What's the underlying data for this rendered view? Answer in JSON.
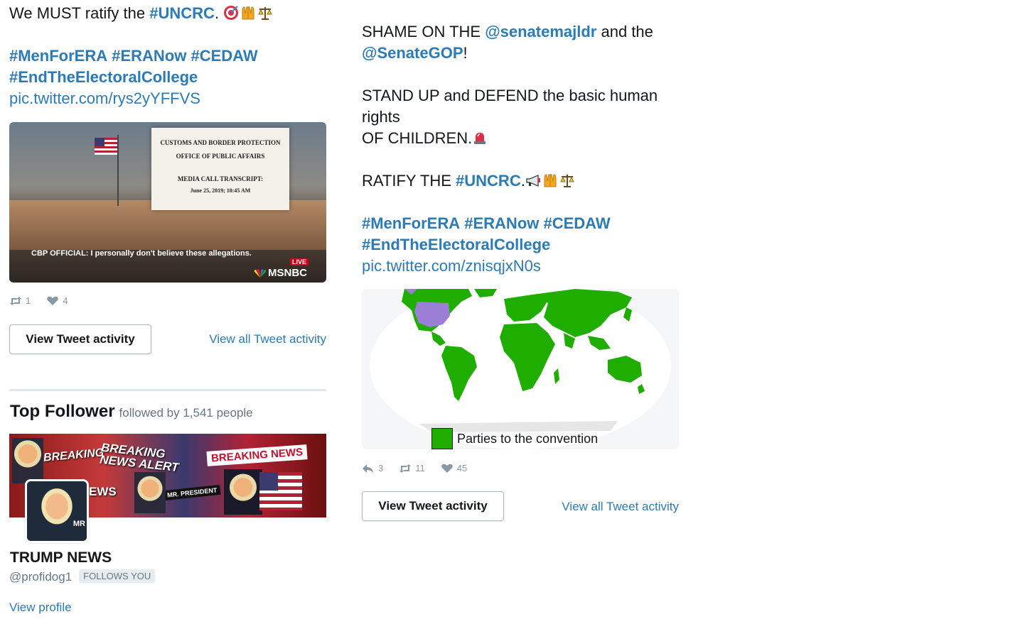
{
  "left_tweet": {
    "line1_prefix": "We MUST ratify the ",
    "line1_tag": "#UNCRC",
    "line1_suffix": ".",
    "emojis1": [
      "target-icon",
      "raised-hands-icon",
      "scales-icon"
    ],
    "tags_line1": [
      "#MenForERA",
      "#ERANow",
      "#CEDAW"
    ],
    "tags_line2": "#EndTheElectoralCollege",
    "pic_link": "pic.twitter.com/rys2yYFFVS",
    "media": {
      "doc_line1": "CUSTOMS AND BORDER PROTECTION",
      "doc_line2": "OFFICE OF PUBLIC AFFAIRS",
      "doc_line3": "MEDIA CALL TRANSCRIPT:",
      "doc_line4": "June 25, 2019; 10:45 AM",
      "caption": "CBP OFFICIAL: I personally don't believe these allegations.",
      "live": "LIVE",
      "network": "MSNBC"
    },
    "retweets": "1",
    "likes": "4",
    "view_button": "View Tweet activity",
    "view_all_link": "View all Tweet activity"
  },
  "top_follower": {
    "title": "Top Follower",
    "subtitle": "followed by 1,541 people",
    "banner_texts": [
      "BREAKING",
      "BREAKING NEWS ALERT",
      "BREAKING NEWS",
      "MR. PRESIDENT",
      "EWS"
    ],
    "avatar_text": "MR",
    "name": "TRUMP NEWS",
    "handle": "@profidog1",
    "badge": "FOLLOWS YOU",
    "view_profile": "View profile"
  },
  "right_tweet": {
    "line1_prefix": "SHAME ON THE ",
    "mention1": "@senatemajldr",
    "line1_suffix": " and the",
    "mention2": "@SenateGOP",
    "line2_suffix": "!",
    "line3": "STAND UP and DEFEND the basic human",
    "line4": "rights",
    "line5": "OF CHILDREN.",
    "emoji_line5": "siren-icon",
    "line6_prefix": "RATIFY THE ",
    "line6_tag": "#UNCRC",
    "line6_suffix": ".",
    "emojis6": [
      "megaphone-icon",
      "raised-hands-icon",
      "scales-icon"
    ],
    "tags_line1": [
      "#MenForERA",
      "#ERANow",
      "#CEDAW"
    ],
    "tags_line2": "#EndTheElectoralCollege",
    "pic_link": "pic.twitter.com/znisqjxN0s",
    "map_legend": "Parties to the convention",
    "replies": "3",
    "retweets": "11",
    "likes": "45",
    "view_button": "View Tweet activity",
    "view_all_link": "View all Tweet activity"
  },
  "colors": {
    "link": "#2b7bb9",
    "text": "#14171a",
    "muted": "#8899a6",
    "map_parties": "#1fae00",
    "map_non_party": "#9b7fd6"
  }
}
